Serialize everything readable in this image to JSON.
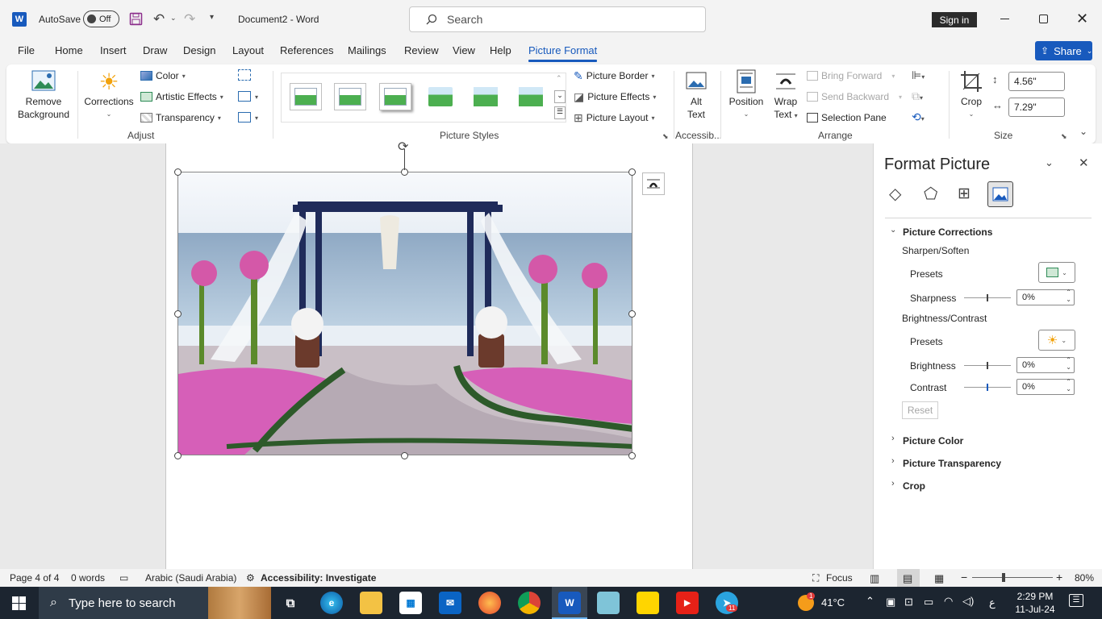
{
  "app": {
    "autosave_label": "AutoSave",
    "autosave_state": "Off",
    "doc_title": "Document2  -  Word",
    "search_placeholder": "Search",
    "sign_in": "Sign in"
  },
  "tabs": [
    "File",
    "Home",
    "Insert",
    "Draw",
    "Design",
    "Layout",
    "References",
    "Mailings",
    "Review",
    "View",
    "Help",
    "Picture Format"
  ],
  "share_label": "Share",
  "ribbon": {
    "remove_bg": [
      "Remove",
      "Background"
    ],
    "corrections": "Corrections",
    "color": "Color",
    "artistic": "Artistic Effects",
    "transparency": "Transparency",
    "adjust_label": "Adjust",
    "styles_label": "Picture Styles",
    "border": "Picture Border",
    "effects": "Picture Effects",
    "layout": "Picture Layout",
    "alt_text": [
      "Alt",
      "Text"
    ],
    "accessib_label": "Accessib...",
    "position": "Position",
    "wrap_text": [
      "Wrap",
      "Text"
    ],
    "bring_forward": "Bring Forward",
    "send_backward": "Send Backward",
    "selection_pane": "Selection Pane",
    "arrange_label": "Arrange",
    "crop": "Crop",
    "height": "4.56\"",
    "width": "7.29\"",
    "size_label": "Size"
  },
  "pane": {
    "title": "Format Picture",
    "section": "Picture Corrections",
    "sharpen_soften": "Sharpen/Soften",
    "presets": "Presets",
    "sharpness": "Sharpness",
    "sharpness_val": "0%",
    "brightness_contrast": "Brightness/Contrast",
    "presets2": "Presets",
    "brightness": "Brightness",
    "brightness_val": "0%",
    "contrast": "Contrast",
    "contrast_val": "0%",
    "reset": "Reset",
    "picture_color": "Picture Color",
    "picture_transparency": "Picture Transparency",
    "crop": "Crop"
  },
  "status": {
    "page": "Page 4 of 4",
    "words": "0 words",
    "language": "Arabic (Saudi Arabia)",
    "accessibility": "Accessibility: Investigate",
    "focus": "Focus",
    "zoom": "80%"
  },
  "taskbar": {
    "search_placeholder": "Type here to search",
    "weather": "41°C",
    "lang": "ع",
    "time": "2:29 PM",
    "date": "11-Jul-24",
    "telegram_badge": "11",
    "notif_badge": "1"
  }
}
